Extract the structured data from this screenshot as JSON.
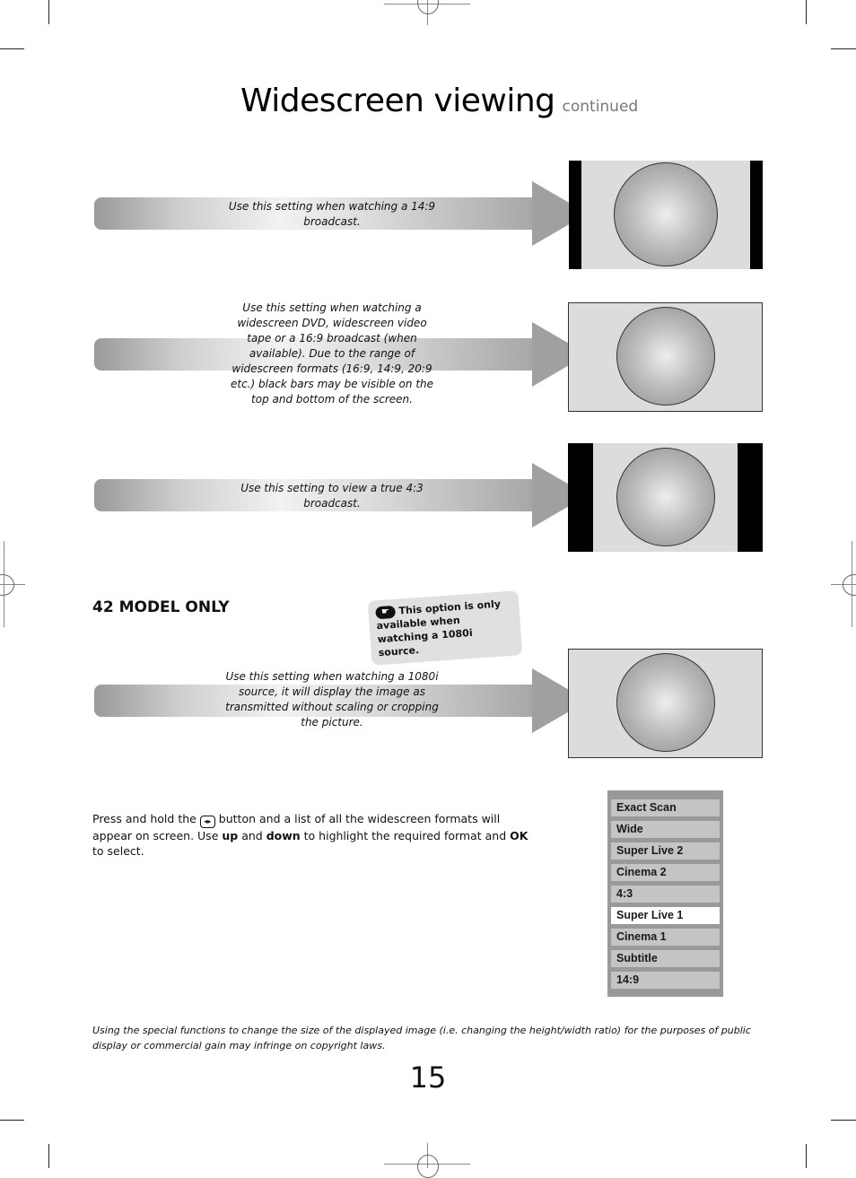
{
  "page": {
    "title": "Widescreen viewing",
    "title_suffix": "continued",
    "page_number": "15"
  },
  "formats": [
    {
      "name": "14:9",
      "caption": "Use this setting when watching a 14:9 broadcast."
    },
    {
      "name": "Wide",
      "caption": "Use this setting when watching a widescreen DVD, widescreen video tape or a 16:9 broadcast (when available). Due to the range of widescreen formats (16:9, 14:9, 20:9 etc.) black bars may be visible on the top and bottom of the screen."
    },
    {
      "name": "4:3",
      "caption": "Use this setting to view a true 4:3 broadcast."
    },
    {
      "name": "Exact Scan",
      "caption": "Use this setting when watching a 1080i source, it will display the image as transmitted without scaling or cropping the picture."
    }
  ],
  "model_section": {
    "heading": "42 MODEL ONLY",
    "note_icon": "pointing-hand-icon",
    "note": "This option is only available when watching a 1080i source."
  },
  "instructions": {
    "part1": "Press and hold the ",
    "button_icon": "widescreen-button-icon",
    "part2": " button and a list of all the widescreen formats will appear on screen. Use ",
    "up": "up",
    "part3": " and ",
    "down": "down",
    "part4": " to highlight the required format and ",
    "ok": "OK",
    "part5": " to select."
  },
  "format_menu": {
    "items": [
      "Exact Scan",
      "Wide",
      "Super Live 2",
      "Cinema 2",
      "4:3",
      "Super Live 1",
      "Cinema 1",
      "Subtitle",
      "14:9"
    ],
    "selected": "Super Live 1"
  },
  "footer_note": "Using the special functions to change the size of the displayed image (i.e. changing the height/width ratio) for the purposes of public display or commercial gain may infringe on copyright laws."
}
